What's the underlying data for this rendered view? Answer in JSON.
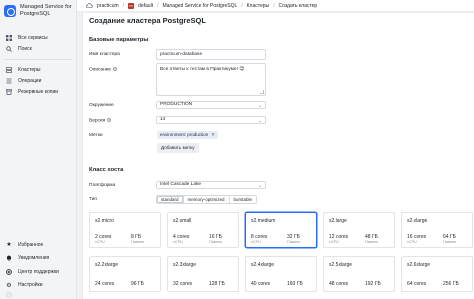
{
  "sidebar": {
    "brand": "Managed Service for PostgreSQL",
    "items": [
      {
        "label": "Все сервисы",
        "icon": "grid-icon"
      },
      {
        "label": "Поиск",
        "icon": "search-icon"
      }
    ],
    "section_items": [
      {
        "label": "Кластеры",
        "icon": "server-icon"
      },
      {
        "label": "Операции",
        "icon": "list-icon"
      },
      {
        "label": "Резервные копии",
        "icon": "archive-icon"
      }
    ],
    "bottom_items": [
      {
        "label": "Избранное",
        "icon": "star-icon"
      },
      {
        "label": "Уведомления",
        "icon": "bell-icon"
      },
      {
        "label": "Центр поддержки",
        "icon": "help-icon"
      },
      {
        "label": "Настройки",
        "icon": "gear-icon"
      }
    ]
  },
  "topbar": {
    "cloud": "practicum",
    "folder_badge": "m",
    "folder": "default",
    "crumbs": [
      "Managed Service for PostgreSQL",
      "Кластеры",
      "Создать кластер"
    ]
  },
  "page": {
    "title": "Создание кластера PostgreSQL",
    "basic_section": "Базовые параметры",
    "fields": {
      "name_label": "Имя кластера",
      "name_value": "practicum-database",
      "desc_label": "Описание",
      "desc_value": "Все ответы к тестам в Практикуме! 😉",
      "env_label": "Окружение",
      "env_value": "PRODUCTION",
      "version_label": "Версия",
      "version_value": "14",
      "labels_label": "Метки",
      "label_chip": "environment: production",
      "add_label_button": "Добавить метку"
    },
    "host_section": "Класс хоста",
    "platform_label": "Платформа",
    "platform_value": "Intel Cascade Lake",
    "type_label": "Тип",
    "types": [
      "standard",
      "memory-optimized",
      "burstable"
    ],
    "selected_type": "standard"
  },
  "hosts": {
    "vcpu_caption": "vCPU",
    "memory_caption": "Память",
    "selected": "s2.medium",
    "classes": [
      {
        "name": "s2.micro",
        "cores": "2 cores",
        "ram": "8 ГБ"
      },
      {
        "name": "s2.small",
        "cores": "4 cores",
        "ram": "16 ГБ"
      },
      {
        "name": "s2.medium",
        "cores": "8 cores",
        "ram": "32 ГБ"
      },
      {
        "name": "s2.large",
        "cores": "12 cores",
        "ram": "48 ГБ"
      },
      {
        "name": "s2.xlarge",
        "cores": "16 cores",
        "ram": "64 ГБ"
      },
      {
        "name": "s2.2xlarge",
        "cores": "24 cores",
        "ram": "96 ГБ"
      },
      {
        "name": "s2.3xlarge",
        "cores": "32 cores",
        "ram": "128 ГБ"
      },
      {
        "name": "s2.4xlarge",
        "cores": "40 cores",
        "ram": "160 ГБ"
      },
      {
        "name": "s2.5xlarge",
        "cores": "48 cores",
        "ram": "192 ГБ"
      },
      {
        "name": "s2.6xlarge",
        "cores": "64 cores",
        "ram": "256 ГБ"
      }
    ]
  },
  "colors": {
    "accent": "#2b6df2",
    "sidebar_bg": "#f3f4f6",
    "main_bg": "#eef0f3",
    "folder_badge": "#b73b2b"
  }
}
